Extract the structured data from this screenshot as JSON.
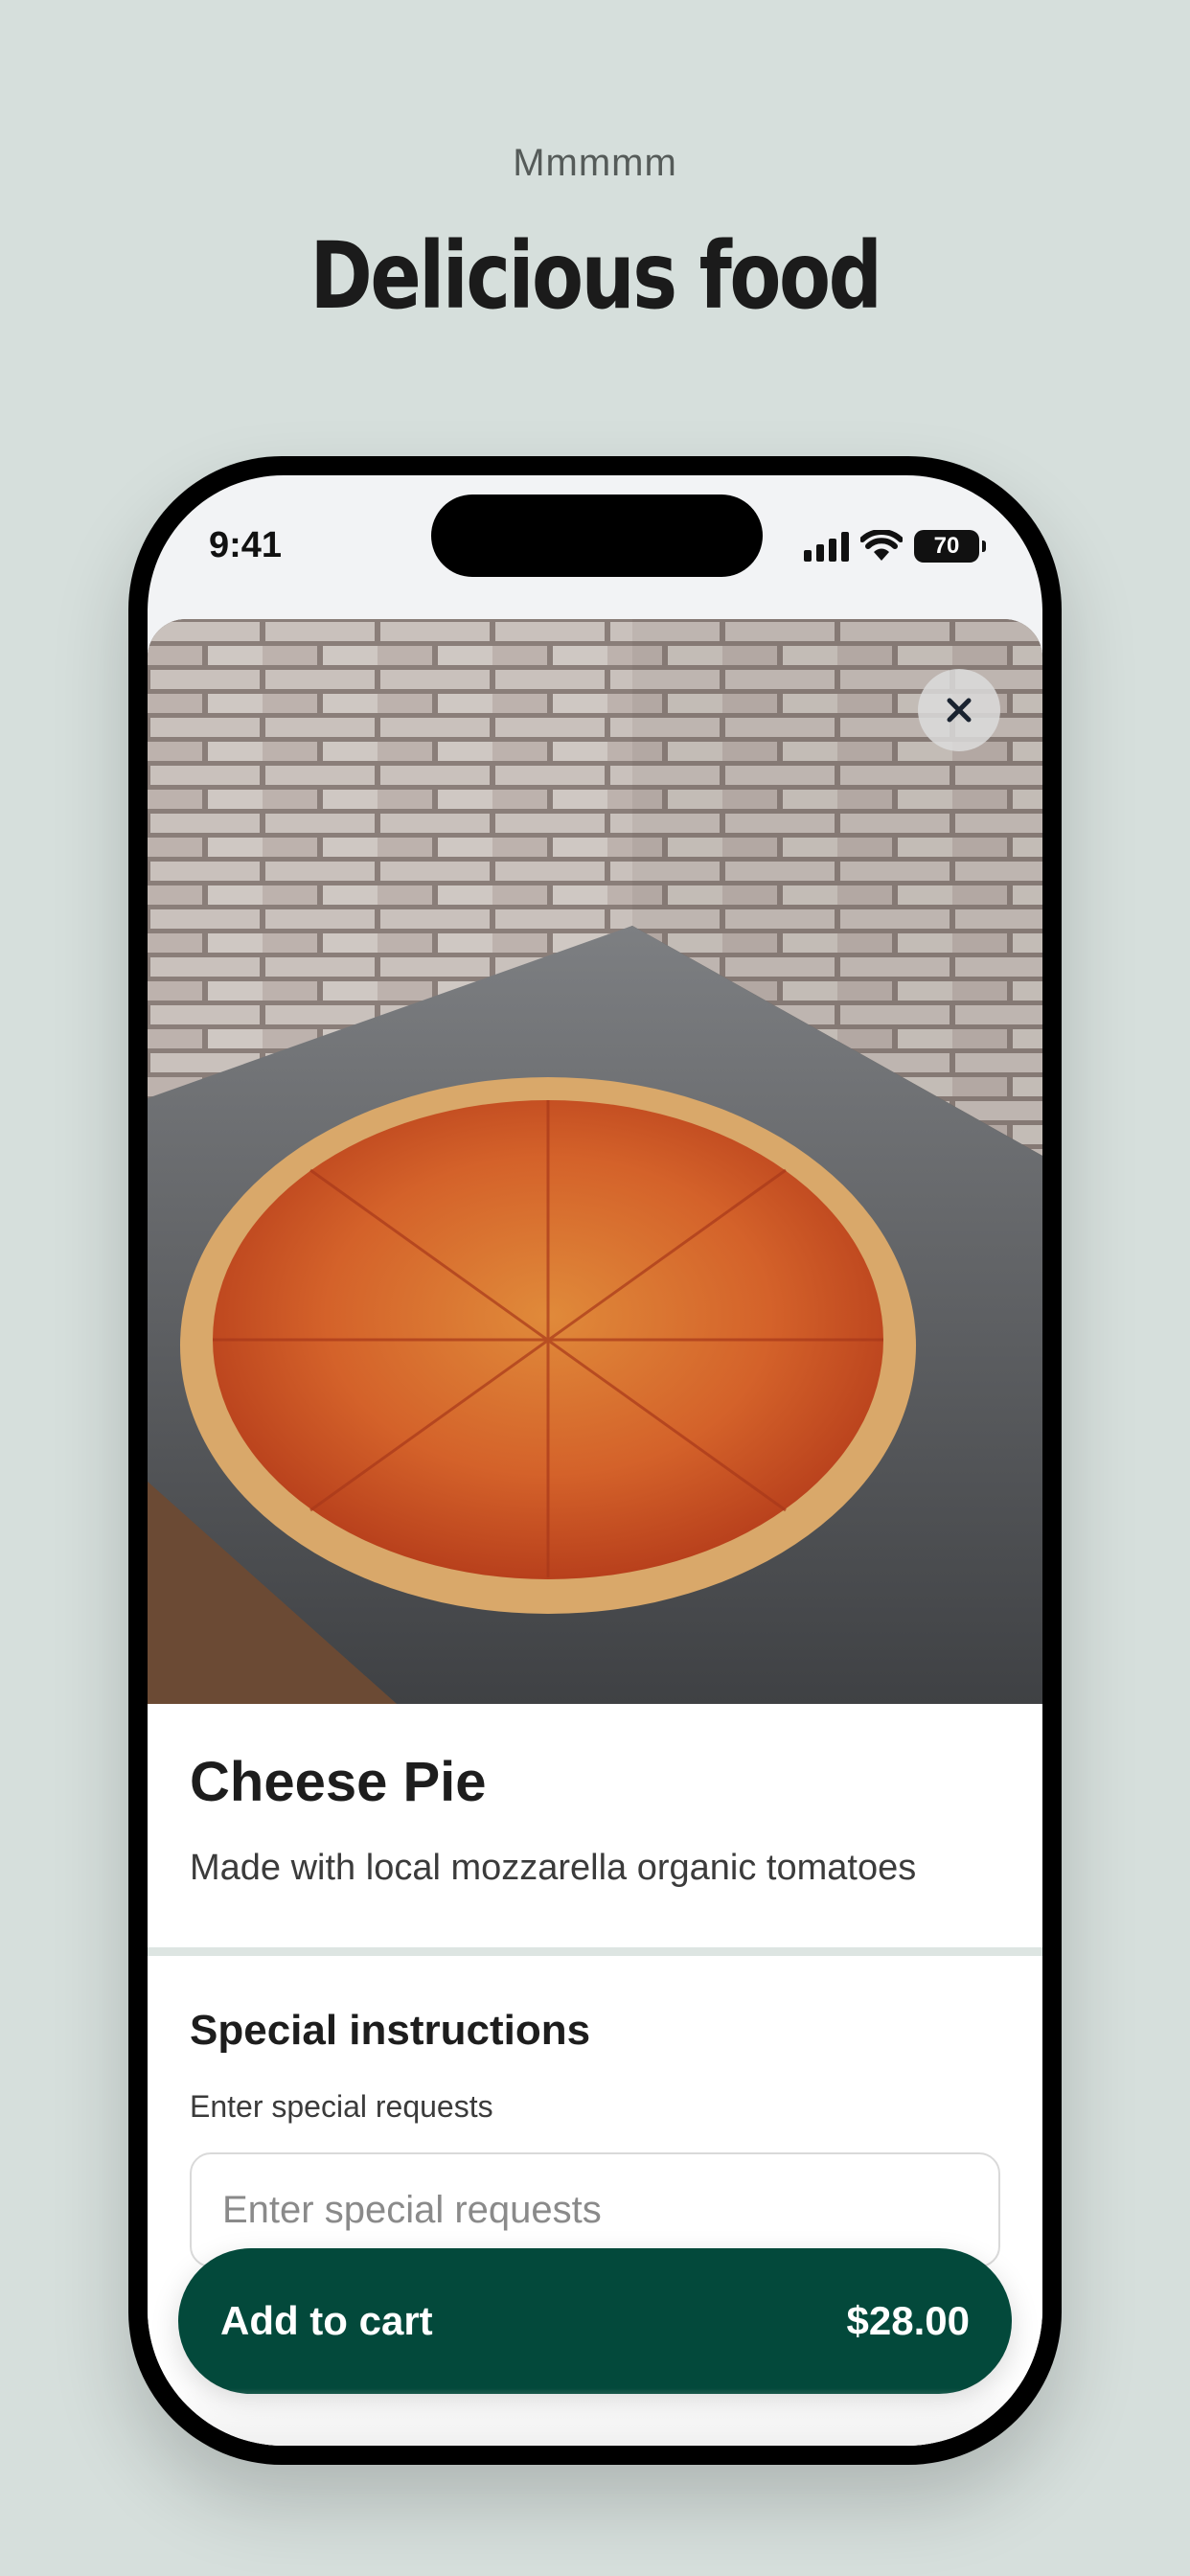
{
  "header": {
    "kicker": "Mmmmm",
    "headline": "Delicious food"
  },
  "status_bar": {
    "time": "9:41",
    "battery": "70",
    "icons": [
      "signal-icon",
      "wifi-icon",
      "battery-icon"
    ]
  },
  "item": {
    "image_icon": "pizza-photo",
    "close_icon": "close-icon",
    "title": "Cheese Pie",
    "description": "Made with local mozzarella organic tomatoes"
  },
  "instructions": {
    "title": "Special instructions",
    "label": "Enter special requests",
    "placeholder": "Enter special requests",
    "value": ""
  },
  "cart": {
    "label": "Add to cart",
    "price": "$28.00"
  },
  "colors": {
    "background": "#d6dfdc",
    "accent": "#03493b",
    "divider": "#dde5e2"
  }
}
